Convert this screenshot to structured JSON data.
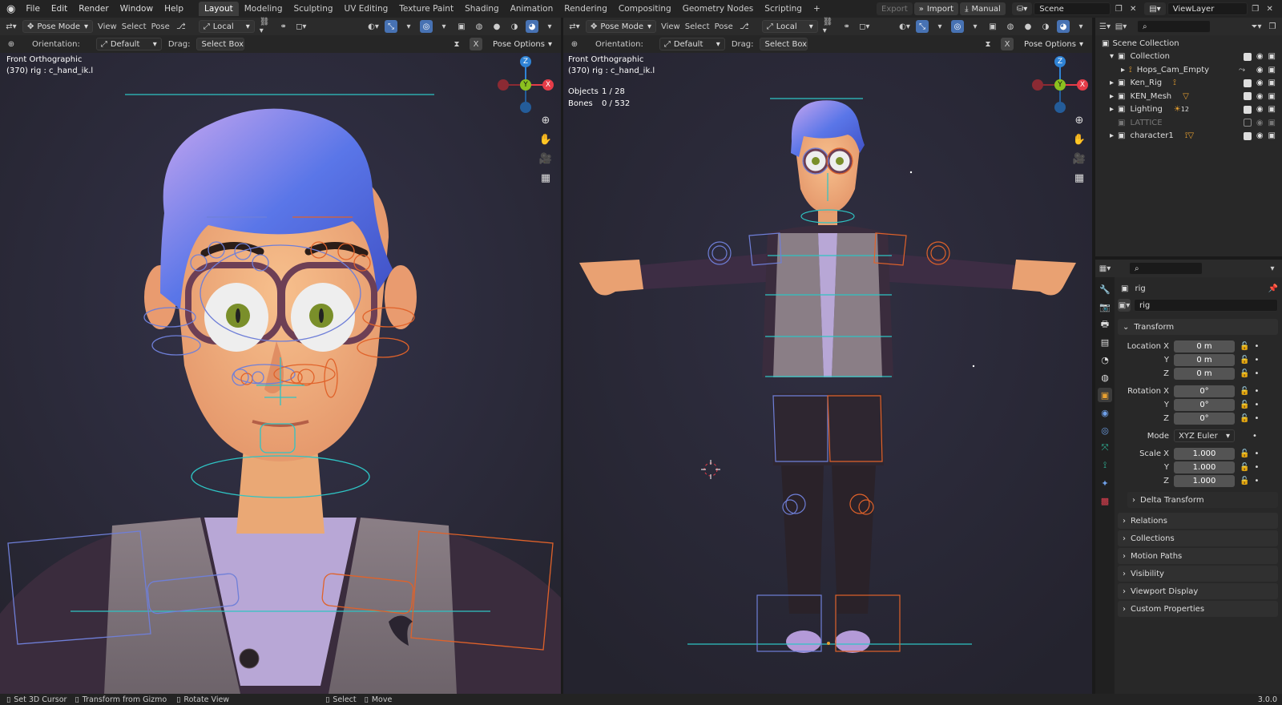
{
  "menu": [
    "File",
    "Edit",
    "Render",
    "Window",
    "Help"
  ],
  "workspaces": [
    "Layout",
    "Modeling",
    "Sculpting",
    "UV Editing",
    "Texture Paint",
    "Shading",
    "Animation",
    "Rendering",
    "Compositing",
    "Geometry Nodes",
    "Scripting"
  ],
  "active_workspace": "Layout",
  "topright": {
    "export": "Export",
    "import": "Import",
    "manual": "Manual",
    "scene": "Scene",
    "view_layer": "ViewLayer"
  },
  "vp_left": {
    "mode": "Pose Mode",
    "view": "View",
    "select": "Select",
    "pose": "Pose",
    "transform_orient": "Local",
    "orientation_label": "Orientation:",
    "orientation_value": "Default",
    "drag_label": "Drag:",
    "drag_value": "Select Box",
    "pose_options": "Pose Options",
    "x_label": "X",
    "overlay1": "Front Orthographic",
    "overlay2": "(370) rig : c_hand_ik.l"
  },
  "vp_right": {
    "mode": "Pose Mode",
    "view": "View",
    "select": "Select",
    "pose": "Pose",
    "transform_orient": "Local",
    "orientation_label": "Orientation:",
    "orientation_value": "Default",
    "drag_label": "Drag:",
    "drag_value": "Select Box",
    "pose_options": "Pose Options",
    "x_label": "X",
    "overlay1": "Front Orthographic",
    "overlay2": "(370) rig : c_hand_ik.l",
    "objects_label": "Objects",
    "objects_value": "1 / 28",
    "bones_label": "Bones",
    "bones_value": "0 / 532"
  },
  "gizmo": {
    "z": "Z",
    "y": "Y",
    "x": "X"
  },
  "outliner": {
    "scene_collection": "Scene Collection",
    "items": [
      {
        "name": "Collection",
        "level": 0
      },
      {
        "name": "Hops_Cam_Empty",
        "level": 1
      },
      {
        "name": "Ken_Rig",
        "level": 0
      },
      {
        "name": "KEN_Mesh",
        "level": 0
      },
      {
        "name": "Lighting",
        "level": 0,
        "badge": "12"
      },
      {
        "name": "LATTICE",
        "level": 0,
        "disabled": true
      },
      {
        "name": "character1",
        "level": 0
      }
    ]
  },
  "properties": {
    "object_name": "rig",
    "datablock": "rig",
    "transform_title": "Transform",
    "location_label": "Location X",
    "y_label": "Y",
    "z_label": "Z",
    "location": [
      "0 m",
      "0 m",
      "0 m"
    ],
    "rotation_label": "Rotation X",
    "rotation": [
      "0°",
      "0°",
      "0°"
    ],
    "mode_label": "Mode",
    "mode_value": "XYZ Euler",
    "scale_label": "Scale X",
    "scale": [
      "1.000",
      "1.000",
      "1.000"
    ],
    "delta_transform": "Delta Transform",
    "panels": [
      "Relations",
      "Collections",
      "Motion Paths",
      "Visibility",
      "Viewport Display",
      "Custom Properties"
    ]
  },
  "statusbar": {
    "set_cursor": "Set 3D Cursor",
    "transform_gizmo": "Transform from Gizmo",
    "rotate_view": "Rotate View",
    "select": "Select",
    "move": "Move",
    "version": "3.0.0"
  },
  "colors": {
    "accent": "#4772b3",
    "viewport_bg": "#2c2b3c",
    "bone_blue": "#6f7fd8",
    "bone_orange": "#e0622a",
    "bone_cyan": "#2ec4c4",
    "gizmo_x": "#e63c48",
    "gizmo_y": "#8bc11f",
    "gizmo_z": "#2f83d6"
  }
}
